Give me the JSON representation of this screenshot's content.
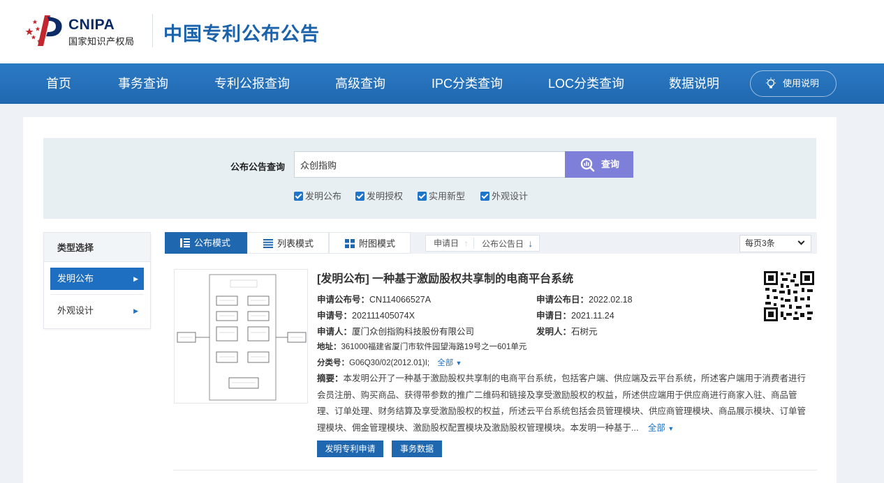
{
  "header": {
    "logo_en": "CNIPA",
    "logo_cn": "国家知识产权局",
    "site_title": "中国专利公布公告"
  },
  "nav": {
    "items": [
      "首页",
      "事务查询",
      "专利公报查询",
      "高级查询",
      "IPC分类查询",
      "LOC分类查询",
      "数据说明"
    ],
    "help_label": "使用说明",
    "help_icon": "lightbulb-icon"
  },
  "search": {
    "label": "公布公告查询",
    "value": "众创指购",
    "button_label": "查询",
    "button_icon": "search-icon",
    "options": [
      {
        "label": "发明公布",
        "checked": true
      },
      {
        "label": "发明授权",
        "checked": true
      },
      {
        "label": "实用新型",
        "checked": true
      },
      {
        "label": "外观设计",
        "checked": true
      }
    ]
  },
  "sidebar": {
    "title": "类型选择",
    "items": [
      {
        "label": "发明公布",
        "active": true
      },
      {
        "label": "外观设计",
        "active": false
      }
    ]
  },
  "view_modes": [
    "公布模式",
    "列表模式",
    "附图模式"
  ],
  "sort": {
    "apply_date": "申请日",
    "pub_date": "公布公告日"
  },
  "per_page": "每页3条",
  "result": {
    "title": "[发明公布] 一种基于激励股权共享制的电商平台系统",
    "pub_no_label": "申请公布号：",
    "pub_no": "CN114066527A",
    "pub_date_label": "申请公布日：",
    "pub_date": "2022.02.18",
    "app_no_label": "申请号：",
    "app_no": "202111405074X",
    "app_date_label": "申请日：",
    "app_date": "2021.11.24",
    "applicant_label": "申请人：",
    "applicant": "厦门众创指购科技股份有限公司",
    "inventor_label": "发明人：",
    "inventor": "石树元",
    "address_label": "地址：",
    "address": "361000福建省厦门市软件园望海路19号之一601单元",
    "class_label": "分类号：",
    "class_no": "G06Q30/02(2012.01)I;",
    "all_label": "全部",
    "abstract_label": "摘要：",
    "abstract": "本发明公开了一种基于激励股权共享制的电商平台系统，包括客户端、供应端及云平台系统，所述客户端用于消费者进行会员注册、购买商品、获得带参数的推广二维码和链接及享受激励股权的权益，所述供应端用于供应商进行商家入驻、商品管理、订单处理、财务结算及享受激励股权的权益，所述云平台系统包括会员管理模块、供应商管理模块、商品展示模块、订单管理模块、佣金管理模块、激励股权配置模块及激励股权管理模块。本发明一种基于...",
    "btn_apply": "发明专利申请",
    "btn_affairs": "事务数据"
  },
  "colors": {
    "brand_blue": "#1f68b0",
    "title_blue": "#1a62a9",
    "search_button": "#7e7fd9",
    "link_blue": "#1e74c9"
  }
}
